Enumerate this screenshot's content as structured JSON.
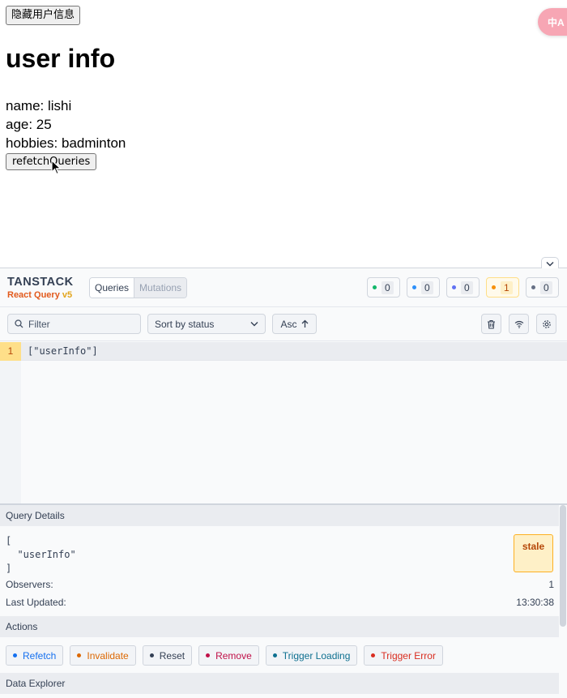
{
  "app": {
    "hide_button": "隐藏用户信息",
    "title": "user info",
    "name_line": "name: lishi",
    "age_line": "age: 25",
    "hobbies_line": "hobbies: badminton",
    "refetch_button": "refetchQueries",
    "translate_fab": "中A"
  },
  "devtools": {
    "brand": {
      "top": "TANSTACK",
      "sub_main": "React Query",
      "sub_version": "v5"
    },
    "tabs": [
      {
        "label": "Queries",
        "active": true
      },
      {
        "label": "Mutations",
        "active": false
      }
    ],
    "status_counts": [
      {
        "status": "fresh",
        "color": "#12b76a",
        "count": "0"
      },
      {
        "status": "fetching",
        "color": "#2e90fa",
        "count": "0"
      },
      {
        "status": "paused",
        "color": "#6172f3",
        "count": "0"
      },
      {
        "status": "stale",
        "color": "#f79009",
        "count": "1"
      },
      {
        "status": "inactive",
        "color": "#667085",
        "count": "0"
      }
    ],
    "filter": {
      "placeholder": "Filter",
      "value": ""
    },
    "sort": {
      "selected": "Sort by status"
    },
    "order": {
      "label": "Asc"
    },
    "queries": [
      {
        "observers": "1",
        "key": "[\"userInfo\"]"
      }
    ],
    "details": {
      "section_title": "Query Details",
      "query_key_lines": "[\n  \"userInfo\"\n]",
      "status_badge": "stale",
      "observers_label": "Observers:",
      "observers_value": "1",
      "last_updated_label": "Last Updated:",
      "last_updated_value": "13:30:38",
      "actions_title": "Actions",
      "actions": [
        {
          "label": "Refetch",
          "color": "#1570ef"
        },
        {
          "label": "Invalidate",
          "color": "#dc6803"
        },
        {
          "label": "Reset",
          "color": "#344054"
        },
        {
          "label": "Remove",
          "color": "#c01048"
        },
        {
          "label": "Trigger Loading",
          "color": "#0e7090"
        },
        {
          "label": "Trigger Error",
          "color": "#d92d20"
        }
      ],
      "data_explorer_title": "Data Explorer"
    }
  }
}
